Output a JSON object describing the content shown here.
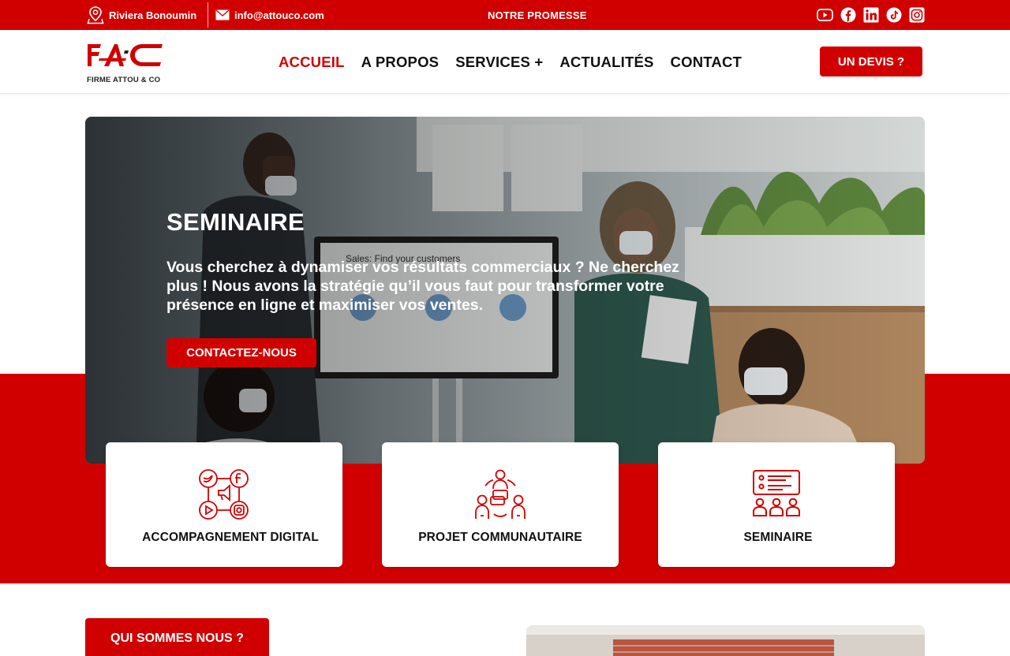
{
  "topbar": {
    "location": "Riviera Bonoumin",
    "email": "info@attouco.com",
    "promise": "NOTRE PROMESSE",
    "social": [
      {
        "icon": "youtube-icon"
      },
      {
        "icon": "facebook-icon"
      },
      {
        "icon": "linkedin-icon"
      },
      {
        "icon": "tiktok-icon"
      },
      {
        "icon": "instagram-icon"
      }
    ]
  },
  "header": {
    "logo_text": "FAC",
    "logo_subtitle": "FIRME ATTOU & CO",
    "nav": [
      {
        "label": "ACCUEIL",
        "active": true
      },
      {
        "label": "A PROPOS",
        "active": false
      },
      {
        "label": "SERVICES +",
        "active": false
      },
      {
        "label": "ACTUALITÉS",
        "active": false
      },
      {
        "label": "CONTACT",
        "active": false
      }
    ],
    "cta": "UN DEVIS ?"
  },
  "hero": {
    "title": "SEMINAIRE",
    "text": "Vous cherchez à dynamiser vos résultats commerciaux ? Ne cherchez plus ! Nous avons la stratégie qu’il vous faut pour transformer votre présence en ligne et maximiser vos ventes.",
    "button": "CONTACTEZ-NOUS",
    "screen_text": "Sales: Find your customers"
  },
  "cards": [
    {
      "label": "ACCOMPAGNEMENT DIGITAL",
      "icon": "social-media-icon"
    },
    {
      "label": "PROJET COMMUNAUTAIRE",
      "icon": "community-icon"
    },
    {
      "label": "SEMINAIRE",
      "icon": "seminar-icon"
    }
  ],
  "about": {
    "heading": "QUI SOMMES NOUS ?"
  },
  "colors": {
    "brand_red": "#d10000",
    "text_dark": "#111111",
    "white": "#ffffff"
  }
}
